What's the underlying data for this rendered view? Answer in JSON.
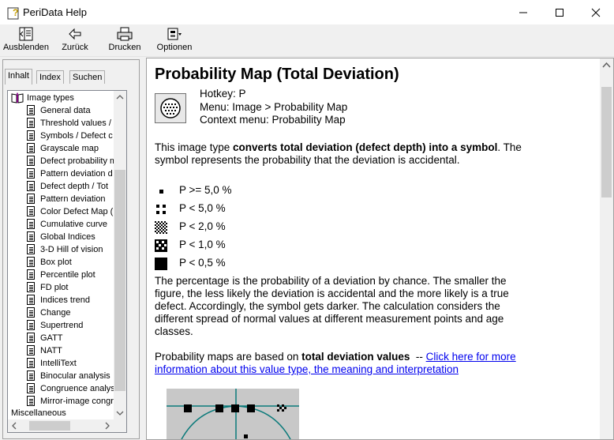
{
  "window": {
    "title": "PeriData Help"
  },
  "toolbar": {
    "hide": "Ausblenden",
    "back": "Zurück",
    "print": "Drucken",
    "options": "Optionen"
  },
  "tabs": [
    {
      "label": "Inhalt"
    },
    {
      "label": "Index"
    },
    {
      "label": "Suchen"
    }
  ],
  "tree": {
    "root": "Image types",
    "items": [
      "General data",
      "Threshold values /",
      "Symbols / Defect c",
      "Grayscale map",
      "Defect probability m",
      "Pattern deviation d",
      "Defect depth / Tot",
      "Pattern deviation",
      "Color Defect Map (",
      "Cumulative curve",
      "Global Indices",
      "3-D Hill of vision",
      "Box plot",
      "Percentile plot",
      "FD plot",
      "Indices trend",
      "Change",
      "Supertrend",
      "GATT",
      "NATT",
      "IntelliText",
      "Binocular analysis",
      "Congruence analys",
      "Mirror-image congr"
    ],
    "misc": "Miscellaneous"
  },
  "page": {
    "title": "Probability Map (Total Deviation)",
    "hotkey": "Hotkey: P",
    "menu": "Menu: Image > Probability Map",
    "context_menu": "Context menu: Probability Map",
    "intro_pre": "This image type ",
    "intro_bold": "converts total deviation (defect depth) into a symbol",
    "intro_post": ". The symbol represents the probability that the deviation is accidental.",
    "legend": [
      {
        "label": "P >= 5,0 %"
      },
      {
        "label": "P < 5,0 %"
      },
      {
        "label": "P < 2,0 %"
      },
      {
        "label": "P < 1,0 %"
      },
      {
        "label": "P < 0,5 %"
      }
    ],
    "paragraph2": "The percentage is the probability of a deviation by chance. The smaller the figure, the less likely the deviation is accidental and the more likely is a true defect. Accordingly, the symbol gets darker. The calculation considers the different spread of normal values at different measurement points and age classes.",
    "para3_pre": "Probability maps are based on ",
    "para3_bold": "total deviation values",
    "para3_sep": "  -- ",
    "para3_link": "Click here for more information about this value type, the meaning and interpretation"
  }
}
